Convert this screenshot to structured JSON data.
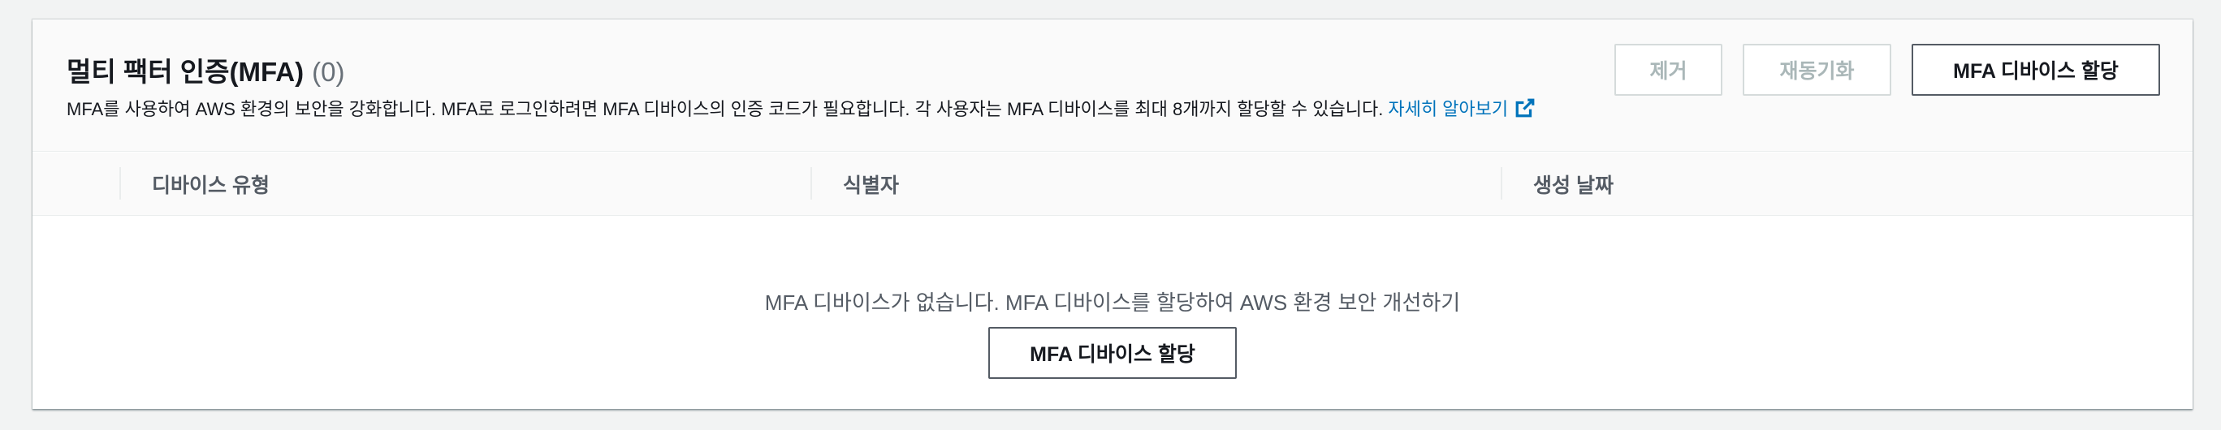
{
  "header": {
    "title": "멀티 팩터 인증(MFA)",
    "count": "(0)",
    "description": "MFA를 사용하여 AWS 환경의 보안을 강화합니다. MFA로 로그인하려면 MFA 디바이스의 인증 코드가 필요합니다. 각 사용자는 MFA 디바이스를 최대 8개까지 할당할 수 있습니다.",
    "learn_more": "자세히 알아보기",
    "external_icon": "external-link-icon"
  },
  "actions": {
    "remove_label": "제거",
    "resync_label": "재동기화",
    "assign_label": "MFA 디바이스 할당"
  },
  "table": {
    "columns": [
      "디바이스 유형",
      "식별자",
      "생성 날짜"
    ]
  },
  "empty_state": {
    "message": "MFA 디바이스가 없습니다. MFA 디바이스를 할당하여 AWS 환경 보안 개선하기",
    "button_label": "MFA 디바이스 할당"
  },
  "colors": {
    "link": "#0073bb",
    "disabled_text": "#aab7b8",
    "border": "#545b64"
  }
}
